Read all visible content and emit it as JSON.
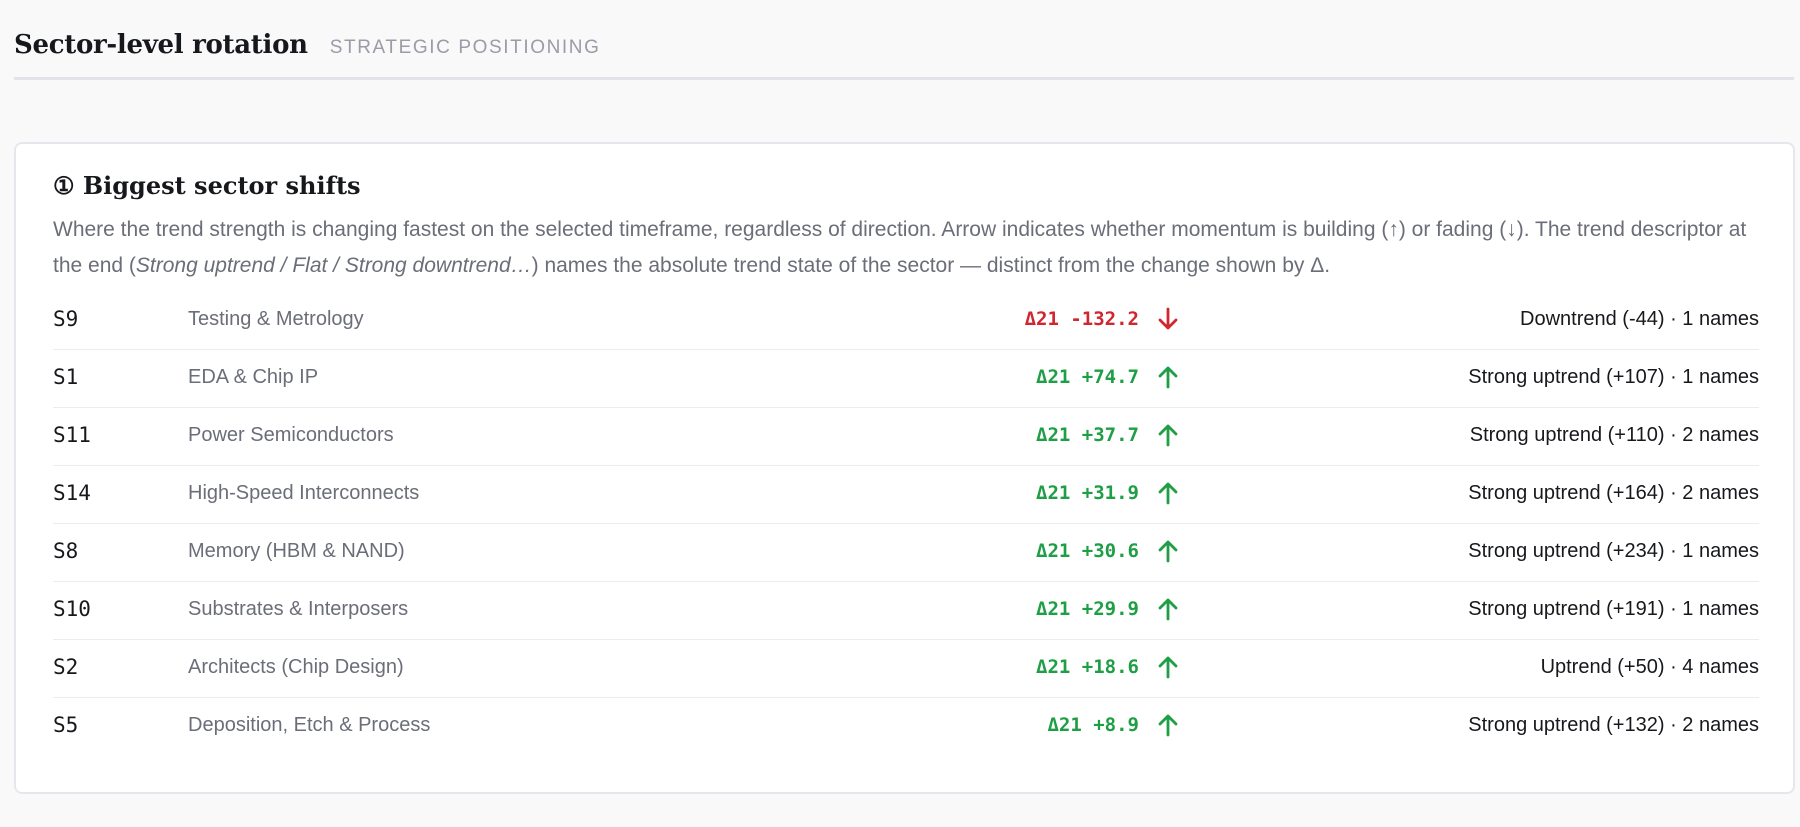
{
  "header": {
    "title": "Sector-level rotation",
    "subtitle": "STRATEGIC POSITIONING"
  },
  "card": {
    "title": "① Biggest sector shifts",
    "desc_part1": "Where the trend strength is changing fastest on the selected timeframe, regardless of direction. Arrow indicates whether momentum is building (↑) or fading (↓). The trend descriptor at the end (",
    "desc_italic": "Strong uptrend / Flat / Strong downtrend…",
    "desc_part2": ") names the absolute trend state of the sector — distinct from the change shown by Δ."
  },
  "colors": {
    "up": "#1e9e45",
    "down": "#d0262f"
  },
  "rows": [
    {
      "code": "S9",
      "name": "Testing & Metrology",
      "delta": "Δ21 -132.2",
      "direction": "down",
      "arrow_icon": "arrow-down-icon",
      "trend": "Downtrend (-44) · 1 names"
    },
    {
      "code": "S1",
      "name": "EDA & Chip IP",
      "delta": "Δ21 +74.7",
      "direction": "up",
      "arrow_icon": "arrow-up-icon",
      "trend": "Strong uptrend (+107) · 1 names"
    },
    {
      "code": "S11",
      "name": "Power Semiconductors",
      "delta": "Δ21 +37.7",
      "direction": "up",
      "arrow_icon": "arrow-up-icon",
      "trend": "Strong uptrend (+110) · 2 names"
    },
    {
      "code": "S14",
      "name": "High-Speed Interconnects",
      "delta": "Δ21 +31.9",
      "direction": "up",
      "arrow_icon": "arrow-up-icon",
      "trend": "Strong uptrend (+164) · 2 names"
    },
    {
      "code": "S8",
      "name": "Memory (HBM & NAND)",
      "delta": "Δ21 +30.6",
      "direction": "up",
      "arrow_icon": "arrow-up-icon",
      "trend": "Strong uptrend (+234) · 1 names"
    },
    {
      "code": "S10",
      "name": "Substrates & Interposers",
      "delta": "Δ21 +29.9",
      "direction": "up",
      "arrow_icon": "arrow-up-icon",
      "trend": "Strong uptrend (+191) · 1 names"
    },
    {
      "code": "S2",
      "name": "Architects (Chip Design)",
      "delta": "Δ21 +18.6",
      "direction": "up",
      "arrow_icon": "arrow-up-icon",
      "trend": "Uptrend (+50) · 4 names"
    },
    {
      "code": "S5",
      "name": "Deposition, Etch & Process",
      "delta": "Δ21 +8.9",
      "direction": "up",
      "arrow_icon": "arrow-up-icon",
      "trend": "Strong uptrend (+132) · 2 names"
    }
  ]
}
